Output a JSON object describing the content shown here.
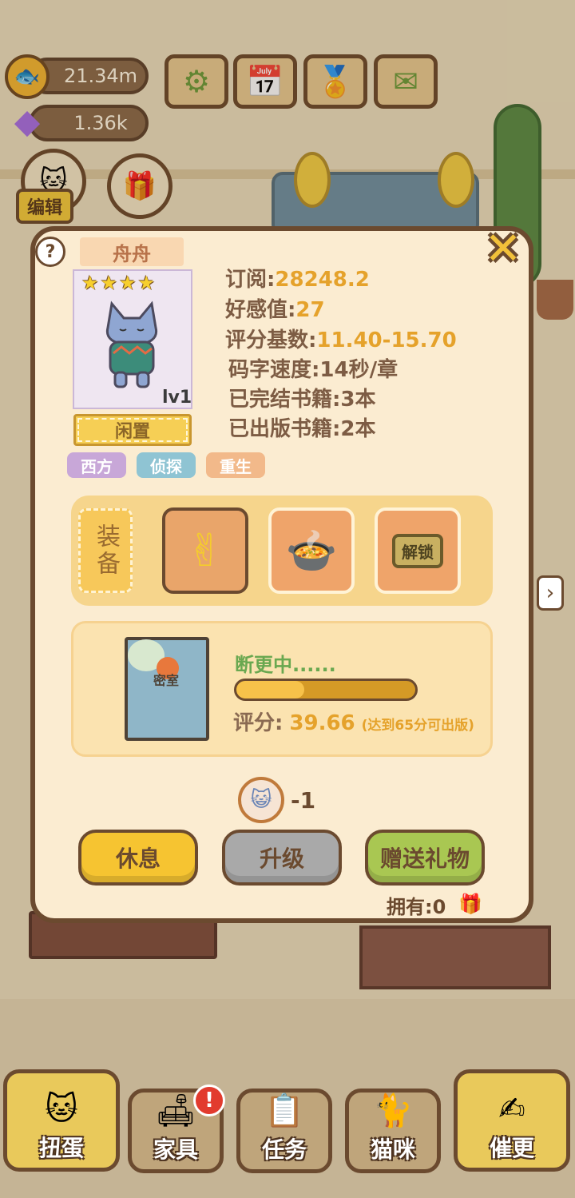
{
  "currencies": {
    "fish": {
      "value": "21.34m",
      "icon": "fish-coin-icon"
    },
    "gems": {
      "value": "1.36k",
      "icon": "diamond-icon"
    }
  },
  "top_buttons": [
    {
      "name": "settings",
      "icon": "⚙"
    },
    {
      "name": "calendar",
      "icon": "📅"
    },
    {
      "name": "achievements",
      "icon": "🏅"
    },
    {
      "name": "mail",
      "icon": "✉"
    }
  ],
  "edit_label": "编辑",
  "cat": {
    "name": "舟舟",
    "stars": 4,
    "level": "lv1",
    "status_button": "闲置",
    "tags": [
      {
        "label": "西方",
        "color": "#c8a7d8"
      },
      {
        "label": "侦探",
        "color": "#8fc4d3"
      },
      {
        "label": "重生",
        "color": "#f2b98a"
      }
    ],
    "stats": [
      {
        "label": "订阅:",
        "value": "28248.2"
      },
      {
        "label": "好感值:",
        "value": "27"
      },
      {
        "label": "评分基数:",
        "value": "11.40-15.70"
      },
      {
        "label": "码字速度:",
        "value": "14秒/章"
      },
      {
        "label": "已完结书籍:",
        "value": "3本"
      },
      {
        "label": "已出版书籍:",
        "value": "2本"
      }
    ]
  },
  "equip": {
    "label": "装备",
    "slots": [
      {
        "icon": "✌",
        "name": "hand-sign"
      },
      {
        "icon": "🍲",
        "name": "food-bowl"
      }
    ],
    "unlock_label": "解锁"
  },
  "book": {
    "title": "密室",
    "status": "断更中......",
    "progress": 0.38,
    "score_label": "评分:",
    "score": "39.66",
    "score_note": "(达到65分可出版)"
  },
  "cost": {
    "value": "-1"
  },
  "actions": {
    "rest": "休息",
    "upgrade": "升级",
    "gift": "赠送礼物"
  },
  "own": {
    "label": "拥有:0"
  },
  "nav": [
    {
      "label": "扭蛋",
      "icon": "🐱"
    },
    {
      "label": "家具",
      "icon": "🛋"
    },
    {
      "label": "任务",
      "icon": "📋"
    },
    {
      "label": "猫咪",
      "icon": "🐈"
    },
    {
      "label": "催更",
      "icon": "✍"
    }
  ],
  "badge": "!"
}
